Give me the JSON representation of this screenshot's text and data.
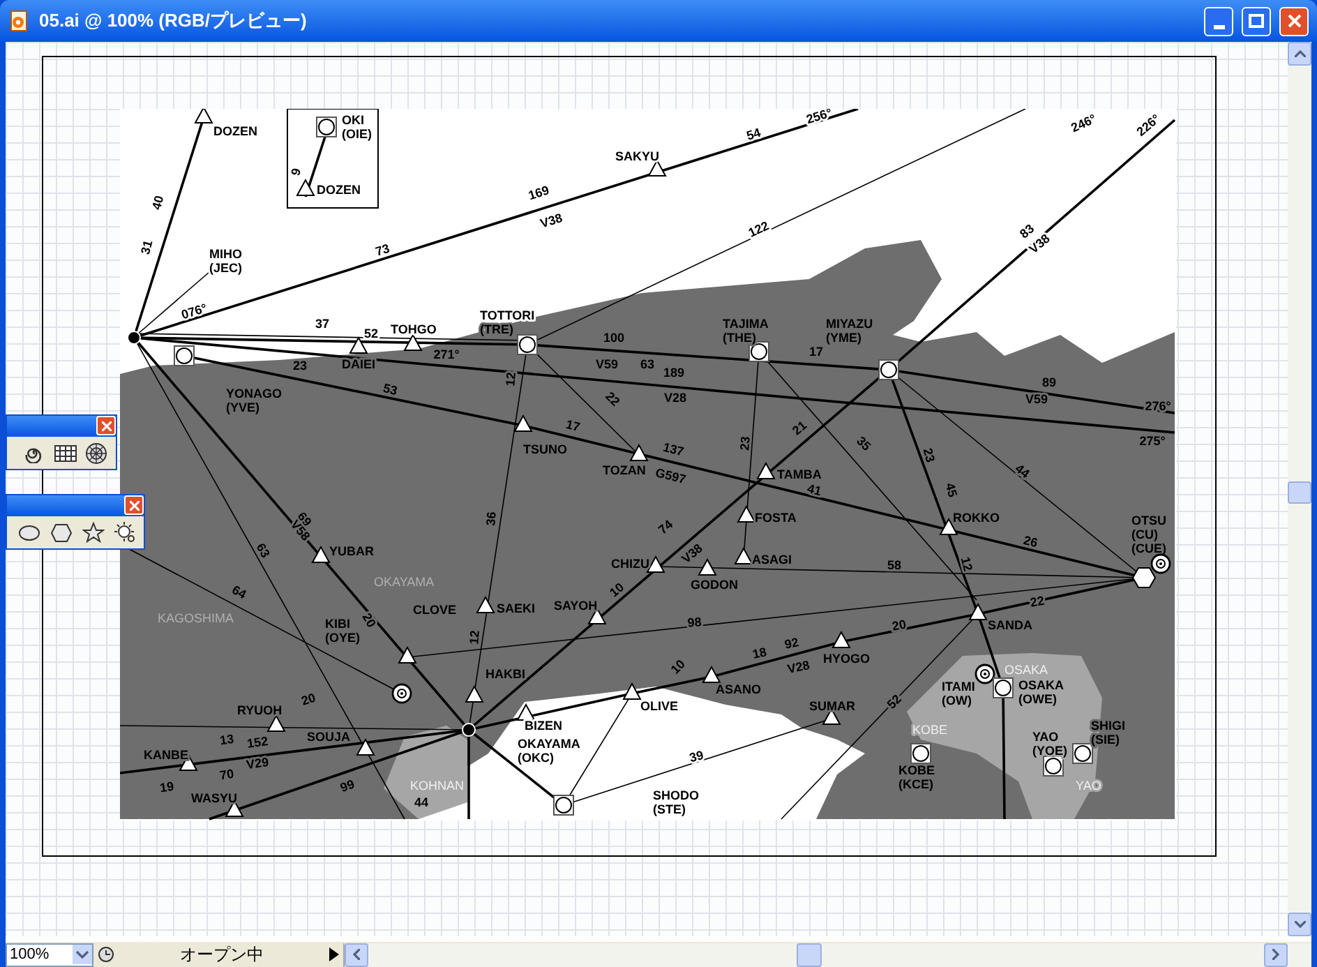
{
  "window": {
    "title": "05.ai @ 100% (RGB/プレビュー)"
  },
  "map": {
    "inset": {
      "waypoints": [
        {
          "kind": "airport",
          "lines": [
            "OKI",
            "(OIE)"
          ]
        },
        {
          "kind": "triangle",
          "lines": [
            "DOZEN"
          ]
        }
      ],
      "route_labels": [
        {
          "text": "9"
        }
      ]
    },
    "waypoints": [
      {
        "kind": "triangle",
        "lines": [
          "DOZEN"
        ]
      },
      {
        "kind": "triangle",
        "lines": [
          "SAKYU"
        ]
      },
      {
        "kind": "label",
        "lines": [
          "MIHO",
          "(JEC)"
        ]
      },
      {
        "kind": "hub"
      },
      {
        "kind": "airport",
        "lines": [
          "YONAGO",
          "(YVE)"
        ]
      },
      {
        "kind": "triangle",
        "lines": [
          "DAIEI"
        ]
      },
      {
        "kind": "triangle",
        "lines": [
          "TOHGO"
        ]
      },
      {
        "kind": "airport",
        "lines": [
          "TOTTORI",
          "(TRE)"
        ]
      },
      {
        "kind": "airport",
        "lines": [
          "TAJIMA",
          "(THE)"
        ]
      },
      {
        "kind": "airport",
        "lines": [
          "MIYAZU",
          "(YME)"
        ]
      },
      {
        "kind": "triangle",
        "lines": [
          "TSUNO"
        ]
      },
      {
        "kind": "triangle",
        "lines": [
          "TOZAN"
        ]
      },
      {
        "kind": "triangle",
        "lines": [
          "TAMBA"
        ]
      },
      {
        "kind": "triangle",
        "lines": [
          "FOSTA"
        ]
      },
      {
        "kind": "triangle",
        "lines": [
          "ASAGI"
        ]
      },
      {
        "kind": "triangle",
        "lines": [
          "ROKKO"
        ]
      },
      {
        "kind": "hexagon",
        "lines": [
          "OTSU",
          "(CU)",
          "(CUE)"
        ]
      },
      {
        "kind": "triangle",
        "lines": [
          "CHIZU"
        ]
      },
      {
        "kind": "triangle",
        "lines": [
          "GODON"
        ]
      },
      {
        "kind": "triangle",
        "lines": [
          "YUBAR"
        ]
      },
      {
        "kind": "area",
        "lines": [
          "OKAYAMA"
        ]
      },
      {
        "kind": "area",
        "lines": [
          "KAGOSHIMA"
        ]
      },
      {
        "kind": "triangle",
        "lines": [
          "CLOVE"
        ]
      },
      {
        "kind": "triangle",
        "lines": [
          "SAEKI"
        ]
      },
      {
        "kind": "triangle",
        "lines": [
          "SAYOH"
        ]
      },
      {
        "kind": "vor",
        "lines": [
          "KIBI",
          "(OYE)"
        ]
      },
      {
        "kind": "triangle",
        "lines": [
          "HAKBI"
        ]
      },
      {
        "kind": "triangle",
        "lines": [
          "BIZEN"
        ]
      },
      {
        "kind": "hub",
        "lines": [
          "OKAYAMA",
          "(OKC)"
        ]
      },
      {
        "kind": "triangle",
        "lines": [
          "OLIVE"
        ]
      },
      {
        "kind": "triangle",
        "lines": [
          "ASANO"
        ]
      },
      {
        "kind": "triangle",
        "lines": [
          "HYOGO"
        ]
      },
      {
        "kind": "triangle",
        "lines": [
          "SANDA"
        ]
      },
      {
        "kind": "triangle",
        "lines": [
          "SUMAR"
        ]
      },
      {
        "kind": "vor",
        "lines": [
          "ITAMI",
          "(OW)"
        ]
      },
      {
        "kind": "area",
        "lines": [
          "OSAKA"
        ]
      },
      {
        "kind": "airport",
        "lines": [
          "OSAKA",
          "(OWE)"
        ]
      },
      {
        "kind": "area",
        "lines": [
          "KOBE"
        ]
      },
      {
        "kind": "airport",
        "lines": [
          "KOBE",
          "(KCE)"
        ]
      },
      {
        "kind": "airport",
        "lines": [
          "YAO",
          "(YOE)"
        ]
      },
      {
        "kind": "airport",
        "lines": [
          "SHIGI",
          "(SIE)"
        ]
      },
      {
        "kind": "area",
        "lines": [
          "YAO"
        ]
      },
      {
        "kind": "triangle",
        "lines": [
          "RYUOH"
        ]
      },
      {
        "kind": "triangle",
        "lines": [
          "SOUJA"
        ]
      },
      {
        "kind": "triangle",
        "lines": [
          "KANBE"
        ]
      },
      {
        "kind": "triangle",
        "lines": [
          "WASYU"
        ]
      },
      {
        "kind": "area",
        "lines": [
          "KOHNAN"
        ]
      },
      {
        "kind": "airport",
        "lines": [
          "SHODO",
          "(STE)"
        ]
      },
      {
        "kind": "vor"
      }
    ],
    "route_labels": [
      {
        "text": "40"
      },
      {
        "text": "31"
      },
      {
        "text": "73"
      },
      {
        "text": "169"
      },
      {
        "text": "V38"
      },
      {
        "text": "54"
      },
      {
        "text": "122"
      },
      {
        "text": "83"
      },
      {
        "text": "V38"
      },
      {
        "text": "37"
      },
      {
        "text": "52"
      },
      {
        "text": "23"
      },
      {
        "text": "V59"
      },
      {
        "text": "63"
      },
      {
        "text": "189"
      },
      {
        "text": "V28"
      },
      {
        "text": "17"
      },
      {
        "text": "89"
      },
      {
        "text": "V59"
      },
      {
        "text": "276°"
      },
      {
        "text": "275°"
      },
      {
        "text": "53"
      },
      {
        "text": "17"
      },
      {
        "text": "137"
      },
      {
        "text": "G597"
      },
      {
        "text": "21"
      },
      {
        "text": "41"
      },
      {
        "text": "26"
      },
      {
        "text": "58"
      },
      {
        "text": "98"
      },
      {
        "text": "20"
      },
      {
        "text": "18"
      },
      {
        "text": "92"
      },
      {
        "text": "V28"
      },
      {
        "text": "12"
      },
      {
        "text": "22"
      },
      {
        "text": "64"
      },
      {
        "text": "20"
      },
      {
        "text": "13"
      },
      {
        "text": "70"
      },
      {
        "text": "152"
      },
      {
        "text": "V29"
      },
      {
        "text": "19"
      },
      {
        "text": "44"
      },
      {
        "text": "39"
      },
      {
        "text": "10"
      },
      {
        "text": "74"
      },
      {
        "text": "V38"
      },
      {
        "text": "69"
      },
      {
        "text": "V58"
      },
      {
        "text": "36"
      },
      {
        "text": "12"
      },
      {
        "text": "52"
      },
      {
        "text": "35"
      },
      {
        "text": "44"
      },
      {
        "text": "23"
      },
      {
        "text": "100"
      },
      {
        "text": "076°"
      },
      {
        "text": "256°"
      },
      {
        "text": "246°"
      },
      {
        "text": "226°"
      },
      {
        "text": "22"
      },
      {
        "text": "12"
      },
      {
        "text": "23"
      },
      {
        "text": "45"
      },
      {
        "text": "271°"
      },
      {
        "text": "10"
      },
      {
        "text": "63"
      },
      {
        "text": "20"
      },
      {
        "text": "99"
      }
    ]
  },
  "status_bar": {
    "zoom": "100%",
    "status": "オープン中"
  }
}
